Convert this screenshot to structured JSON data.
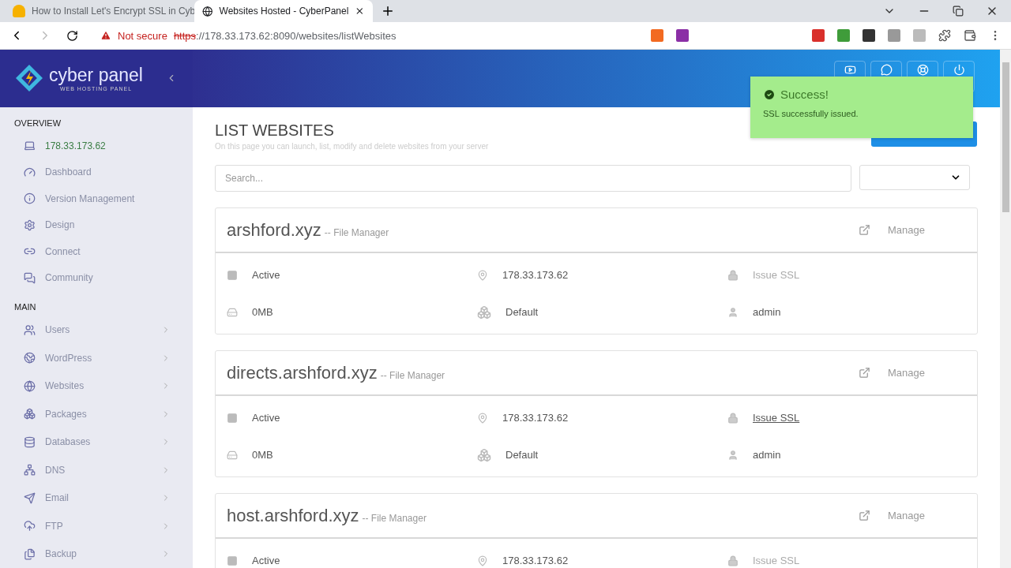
{
  "browser": {
    "tabs": [
      {
        "title": "How to Install Let's Encrypt SSL in Cyb",
        "selected": false
      },
      {
        "title": "Websites Hosted - CyberPanel",
        "selected": true
      }
    ],
    "address": {
      "warning": "Not secure",
      "scheme": "https",
      "rest": "://178.33.173.62:8090/websites/listWebsites"
    }
  },
  "sidebar": {
    "logo": "cyber panel",
    "tagline": "WEB HOSTING PANEL",
    "sections": [
      {
        "title": "OVERVIEW",
        "items": [
          {
            "label": "178.33.173.62",
            "selected": true,
            "expandable": false
          },
          {
            "label": "Dashboard",
            "selected": false,
            "expandable": false
          },
          {
            "label": "Version Management",
            "selected": false,
            "expandable": false
          },
          {
            "label": "Design",
            "selected": false,
            "expandable": false
          },
          {
            "label": "Connect",
            "selected": false,
            "expandable": false
          },
          {
            "label": "Community",
            "selected": false,
            "expandable": false
          }
        ]
      },
      {
        "title": "MAIN",
        "items": [
          {
            "label": "Users",
            "selected": false,
            "expandable": true
          },
          {
            "label": "WordPress",
            "selected": false,
            "expandable": true
          },
          {
            "label": "Websites",
            "selected": false,
            "expandable": true
          },
          {
            "label": "Packages",
            "selected": false,
            "expandable": true
          },
          {
            "label": "Databases",
            "selected": false,
            "expandable": true
          },
          {
            "label": "DNS",
            "selected": false,
            "expandable": true
          },
          {
            "label": "Email",
            "selected": false,
            "expandable": true
          },
          {
            "label": "FTP",
            "selected": false,
            "expandable": true
          },
          {
            "label": "Backup",
            "selected": false,
            "expandable": true
          }
        ]
      }
    ]
  },
  "toast": {
    "title": "Success!",
    "message": "SSL successfully issued."
  },
  "page": {
    "title": "LIST WEBSITES",
    "subtitle": "On this page you can launch, list, modify and delete websites from your server",
    "search": {
      "placeholder": "Search..."
    }
  },
  "websites": [
    {
      "domain": "arshford.xyz",
      "file_manager": "-- File Manager",
      "manage": "Manage",
      "status": "Active",
      "ip": "178.33.173.62",
      "ssl": {
        "label": "Issue SSL",
        "hovered": false
      },
      "disk": "0MB",
      "package": "Default",
      "owner": "admin"
    },
    {
      "domain": "directs.arshford.xyz",
      "file_manager": "-- File Manager",
      "manage": "Manage",
      "status": "Active",
      "ip": "178.33.173.62",
      "ssl": {
        "label": "Issue SSL",
        "hovered": true
      },
      "disk": "0MB",
      "package": "Default",
      "owner": "admin"
    },
    {
      "domain": "host.arshford.xyz",
      "file_manager": "-- File Manager",
      "manage": "Manage",
      "status": "Active",
      "ip": "178.33.173.62",
      "ssl": {
        "label": "Issue SSL",
        "hovered": false
      }
    }
  ]
}
